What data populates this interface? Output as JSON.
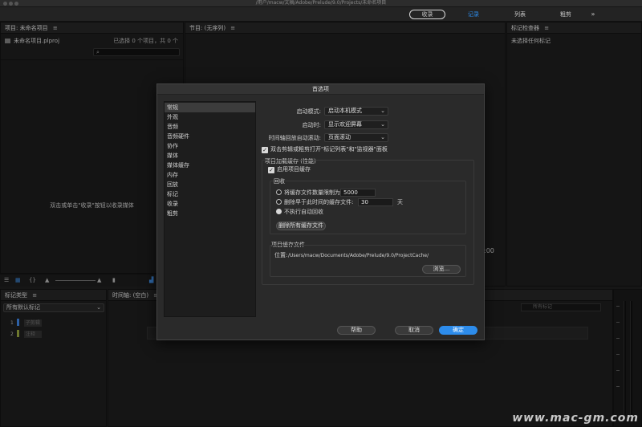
{
  "window": {
    "title": "/用户/macw/文稿/Adobe/Prelude/9.0/Projects/未命名项目"
  },
  "workspaces": {
    "ingest": "收录",
    "log": "记录",
    "list": "列表",
    "rough_cut": "粗剪",
    "more": "»"
  },
  "project_panel": {
    "title": "项目: 未命名项目",
    "menu": "≡",
    "file": "未命名项目.plproj",
    "selection": "已选择 0 个项目，共 0 个",
    "search_icon": "⌕",
    "hint": "双击或单击\"收录\"按钮以收录媒体"
  },
  "program_panel": {
    "title": "节目: (无序列)",
    "menu": "≡",
    "timecode": ":00"
  },
  "inspector_panel": {
    "title": "标记检查器",
    "menu": "≡",
    "empty": "未选择任何标记"
  },
  "marker_type_panel": {
    "title": "标记类型",
    "menu": "≡",
    "select": "所有默认标记",
    "rows": [
      {
        "num": "1",
        "label": "子剪辑",
        "color": "#3a7bd5"
      },
      {
        "num": "2",
        "label": "注释",
        "color": "#8d9a3b"
      }
    ]
  },
  "timeline_panel": {
    "title": "时间轴: (空白)",
    "menu": "≡",
    "search_placeholder": "所有标记"
  },
  "dialog": {
    "title": "首选项",
    "categories": [
      "常规",
      "外观",
      "音频",
      "音频硬件",
      "协作",
      "媒体",
      "媒体缓存",
      "内存",
      "回放",
      "标记",
      "收录",
      "粗剪"
    ],
    "active_category": 0,
    "startup_mode_label": "启动模式:",
    "startup_mode_value": "启动本机模式",
    "startup_label": "启动时:",
    "startup_value": "显示欢迎屏幕",
    "autoscroll_label": "时间轴回放自动滚动:",
    "autoscroll_value": "页面滚动",
    "open_panels_checkbox": "双击剪辑或粗剪打开\"标记列表\"和\"监视器\"面板",
    "cache_group_title": "项目加载缓存 (性能)",
    "enable_cache_checkbox": "启用项目缓存",
    "reclaim_title": "回收",
    "radio_limit_label": "将缓存文件数量限制为",
    "radio_limit_value": "5000",
    "radio_older_label": "删除早于此时间的缓存文件:",
    "radio_older_value": "30",
    "radio_older_unit": "天",
    "radio_none_label": "不执行自动回收",
    "delete_all_button": "删除所有缓存文件",
    "cache_file_title": "项目缓存文件",
    "location_label": "位置:",
    "location_path": "/Users/macw/Documents/Adobe/Prelude/9.0/ProjectCache/",
    "browse_button": "浏览...",
    "help_button": "帮助",
    "cancel_button": "取消",
    "ok_button": "确定"
  },
  "watermark": "www.mac-gm.com"
}
